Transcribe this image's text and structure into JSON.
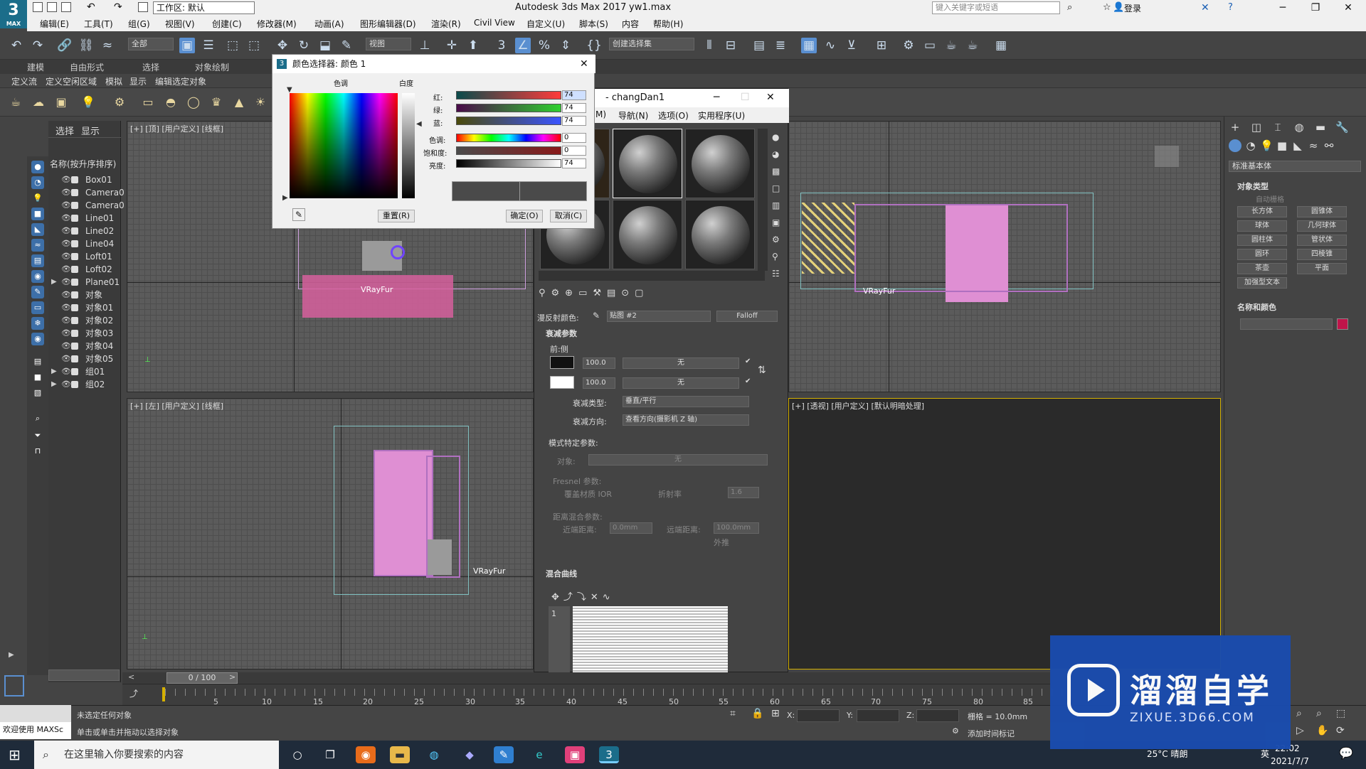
{
  "app": {
    "logo_text": "3",
    "logo_sub": "MAX",
    "title": "Autodesk 3ds Max 2017",
    "filename": "yw1.max",
    "workspace": "工作区: 默认",
    "search_placeholder": "键入关键字或短语",
    "login": "登录"
  },
  "menu": [
    "编辑(E)",
    "工具(T)",
    "组(G)",
    "视图(V)",
    "创建(C)",
    "修改器(M)",
    "动画(A)",
    "图形编辑器(D)",
    "渲染(R)",
    "Civil View",
    "自定义(U)",
    "脚本(S)",
    "内容",
    "帮助(H)"
  ],
  "toolbar": {
    "filter_select": "全部",
    "view_select": "视图",
    "selection_set": "创建选择集"
  },
  "ribbon_tabs": [
    "建模",
    "自由形式",
    "选择",
    "对象绘制"
  ],
  "ribbon_sub": [
    "定义流",
    "定义空闲区域",
    "模拟",
    "显示",
    "编辑选定对象"
  ],
  "scene_explorer": {
    "tabs": [
      "选择",
      "显示"
    ],
    "header": "名称(按升序排序)",
    "items": [
      "Box01",
      "Camera0",
      "Camera0",
      "Line01",
      "Line02",
      "Line04",
      "Loft01",
      "Loft02",
      "Plane01",
      "对象",
      "对象01",
      "对象02",
      "对象03",
      "对象04",
      "对象05",
      "组01",
      "组02"
    ]
  },
  "viewports": {
    "top_label": "[+] [顶] [用户定义] [线框]",
    "left_label": "[+] [左] [用户定义] [线框]",
    "persp_label": "[+] [透视] [用户定义] [默认明暗处理]",
    "vrayfur": "VRayFur"
  },
  "color_picker": {
    "title": "颜色选择器: 颜色 1",
    "hue_label": "色调",
    "white_label": "白度",
    "rows": [
      {
        "label": "红:",
        "value": "74"
      },
      {
        "label": "绿:",
        "value": "74"
      },
      {
        "label": "蓝:",
        "value": "74"
      },
      {
        "label": "色调:",
        "value": "0"
      },
      {
        "label": "饱和度:",
        "value": "0"
      },
      {
        "label": "亮度:",
        "value": "74"
      }
    ],
    "reset": "重置(R)",
    "ok": "确定(O)",
    "cancel": "取消(C)",
    "bar_colors": {
      "red": "#ff3b3b",
      "green": "#2fd12f",
      "blue": "#3b55ff",
      "swatch": "#4a4a4a"
    }
  },
  "material_editor": {
    "title": "- changDan1",
    "menu": [
      "M)",
      "导航(N)",
      "选项(O)",
      "实用程序(U)"
    ],
    "diffuse_label": "漫反射颜色:",
    "map_slot": "贴图 #2",
    "map_type": "Falloff",
    "falloff_rollout": "衰减参数",
    "front_side": "前:侧",
    "amounts": [
      "100.0",
      "100.0"
    ],
    "none": "无",
    "falloff_type_label": "衰减类型:",
    "falloff_type": "垂直/平行",
    "falloff_dir_label": "衰减方向:",
    "falloff_dir": "查看方向(摄影机 Z 轴)",
    "mode_params": "模式特定参数:",
    "object_label": "对象:",
    "fresnel_label": "Fresnel 参数:",
    "override_ior": "覆盖材质 IOR",
    "ior_label": "折射率",
    "ior_value": "1.6",
    "dist_label": "距离混合参数:",
    "near_label": "近端距离:",
    "near_value": "0.0mm",
    "far_label": "远端距离:",
    "far_value": "100.0mm",
    "extrapolate": "外推",
    "mix_curve": "混合曲线",
    "curve_index": "1"
  },
  "command_panel": {
    "dropdown": "标准基本体",
    "object_type": "对象类型",
    "autogrid": "自动栅格",
    "buttons": [
      "长方体",
      "圆锥体",
      "球体",
      "几何球体",
      "圆柱体",
      "管状体",
      "圆环",
      "四棱锥",
      "茶壶",
      "平面",
      "加强型文本"
    ],
    "name_color": "名称和颜色",
    "color_swatch": "#c0144a"
  },
  "timeline": {
    "slider": "0 / 100",
    "ticks": [
      "5",
      "10",
      "15",
      "20",
      "25",
      "30",
      "35",
      "40",
      "45",
      "50",
      "55",
      "60",
      "65",
      "70",
      "75",
      "80",
      "85"
    ]
  },
  "status": {
    "welcome": "欢迎使用 MAXSc",
    "line1": "未选定任何对象",
    "line2": "单击或单击并拖动以选择对象",
    "x_label": "X:",
    "y_label": "Y:",
    "z_label": "Z:",
    "grid": "栅格 = 10.0mm",
    "add_marker": "添加时间标记"
  },
  "taskbar": {
    "search": "在这里输入你要搜索的内容",
    "weather": "25°C 晴朗",
    "ime": "英",
    "time": "22:02",
    "date": "2021/7/7"
  },
  "watermark": {
    "brand": "溜溜自学",
    "url": "ZIXUE.3D66.COM"
  }
}
